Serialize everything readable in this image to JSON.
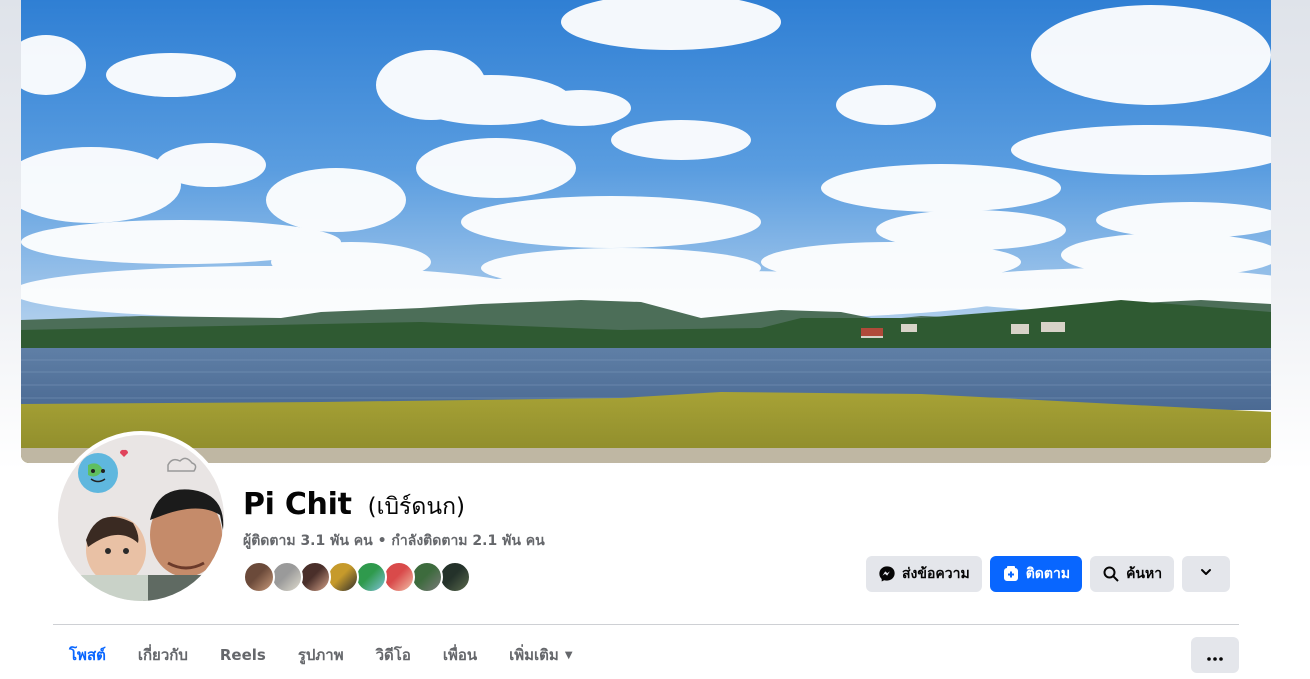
{
  "profile": {
    "name": "Pi Chit",
    "alternate_name": "(เบิร์ดนก)",
    "stats": "ผู้ติดตาม 3.1 พัน คน • กำลังติดตาม 2.1 พัน คน"
  },
  "friend_avatars": [
    {
      "colors": [
        "#6b4a3a",
        "#c99a7b"
      ]
    },
    {
      "colors": [
        "#9a9a9a",
        "#e0dccf"
      ]
    },
    {
      "colors": [
        "#4a2f2a",
        "#d6a48a"
      ]
    },
    {
      "colors": [
        "#c69a2b",
        "#2d2d2d"
      ]
    },
    {
      "colors": [
        "#2f9a4d",
        "#7fc1d8"
      ]
    },
    {
      "colors": [
        "#d94a4a",
        "#f1c0a8"
      ]
    },
    {
      "colors": [
        "#3d6b3d",
        "#7a7a7a"
      ]
    },
    {
      "colors": [
        "#24322a",
        "#5b6b4e"
      ]
    }
  ],
  "actions": {
    "message_label": "ส่งข้อความ",
    "follow_label": "ติดตาม",
    "search_label": "ค้นหา",
    "message_icon": "messenger-icon",
    "follow_icon": "follow-plus-icon",
    "search_icon": "search-icon",
    "dropdown_icon": "chevron-down-icon"
  },
  "tabs": [
    {
      "label": "โพสต์",
      "active": true
    },
    {
      "label": "เกี่ยวกับ",
      "active": false
    },
    {
      "label": "Reels",
      "active": false
    },
    {
      "label": "รูปภาพ",
      "active": false
    },
    {
      "label": "วิดีโอ",
      "active": false
    },
    {
      "label": "เพื่อน",
      "active": false
    },
    {
      "label": "เพิ่มเติม",
      "active": false,
      "dropdown": true
    }
  ],
  "more_options_icon": "ellipsis-icon",
  "colors": {
    "accent": "#0866ff",
    "button_gray": "#e4e6eb",
    "muted_text": "#65676b"
  }
}
